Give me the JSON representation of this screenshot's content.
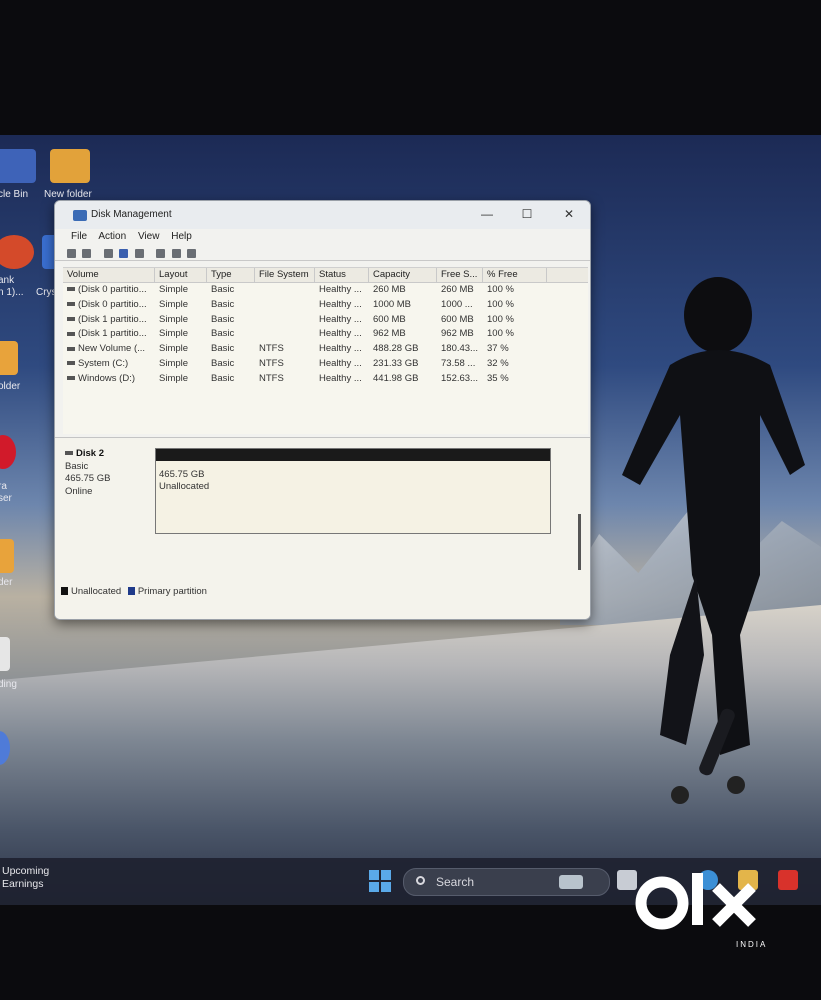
{
  "desktop": {
    "icons": [
      {
        "label": "cle Bin",
        "name": "recycle-bin"
      },
      {
        "label": "New folder",
        "name": "new-folder"
      },
      {
        "label": "ank\nn 1)...",
        "name": "chrome-shortcut"
      },
      {
        "label": "Cryst",
        "name": "crystal-shortcut"
      },
      {
        "label": "older",
        "name": "folder-2"
      },
      {
        "label": "ra\nser",
        "name": "opera-browser"
      },
      {
        "label": "der",
        "name": "folder-3"
      },
      {
        "label": "ding",
        "name": "file-4"
      }
    ]
  },
  "window": {
    "title": "Disk Management",
    "menu": [
      "File",
      "Action",
      "View",
      "Help"
    ],
    "columns": [
      "Volume",
      "Layout",
      "Type",
      "File System",
      "Status",
      "Capacity",
      "Free S...",
      "% Free"
    ],
    "rows": [
      [
        "(Disk 0 partitio...",
        "Simple",
        "Basic",
        "",
        "Healthy ...",
        "260 MB",
        "260 MB",
        "100 %"
      ],
      [
        "(Disk 0 partitio...",
        "Simple",
        "Basic",
        "",
        "Healthy ...",
        "1000 MB",
        "1000 ...",
        "100 %"
      ],
      [
        "(Disk 1 partitio...",
        "Simple",
        "Basic",
        "",
        "Healthy ...",
        "600 MB",
        "600 MB",
        "100 %"
      ],
      [
        "(Disk 1 partitio...",
        "Simple",
        "Basic",
        "",
        "Healthy ...",
        "962 MB",
        "962 MB",
        "100 %"
      ],
      [
        "New Volume (...",
        "Simple",
        "Basic",
        "NTFS",
        "Healthy ...",
        "488.28 GB",
        "180.43...",
        "37 %"
      ],
      [
        "System (C:)",
        "Simple",
        "Basic",
        "NTFS",
        "Healthy ...",
        "231.33 GB",
        "73.58 ...",
        "32 %"
      ],
      [
        "Windows (D:)",
        "Simple",
        "Basic",
        "NTFS",
        "Healthy ...",
        "441.98 GB",
        "152.63...",
        "35 %"
      ]
    ],
    "disk": {
      "name": "Disk 2",
      "type": "Basic",
      "size": "465.75 GB",
      "state": "Online",
      "partition_size": "465.75 GB",
      "partition_label": "Unallocated"
    },
    "legend": {
      "unallocated": "Unallocated",
      "primary": "Primary partition",
      "unallocated_color": "#111111",
      "primary_color": "#1f3a8a"
    }
  },
  "taskbar": {
    "widget_line1": "Upcoming",
    "widget_line2": "Earnings",
    "search_placeholder": "Search"
  },
  "watermark": {
    "brand": "olx",
    "region": "INDIA"
  }
}
